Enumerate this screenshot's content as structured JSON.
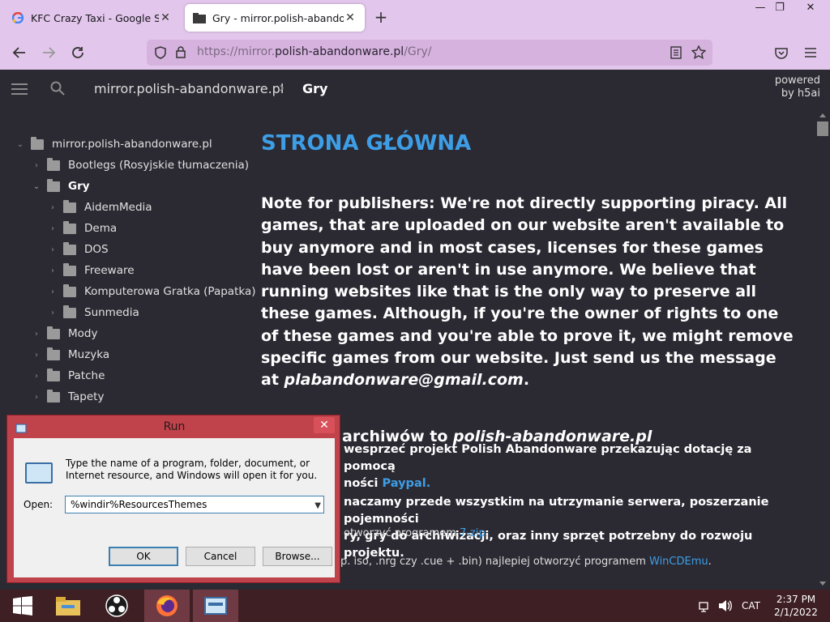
{
  "browser": {
    "tabs": [
      {
        "title": "KFC Crazy Taxi - Google Search",
        "favicon": "google-icon",
        "close": "✕"
      },
      {
        "title": "Gry - mirror.polish-abandonware.pl",
        "favicon": "folder-icon",
        "close": "✕"
      }
    ],
    "new_tab": "+",
    "window_controls": {
      "minimize": "—",
      "maximize": "❐",
      "close": "✕"
    },
    "url": {
      "scheme": "https://",
      "sub": "mirror.",
      "domain": "polish-abandonware.pl",
      "path": "/Gry/"
    }
  },
  "header": {
    "crumb_root": "mirror.polish-abandonware.pl",
    "crumb_sep": "›",
    "crumb_current": "Gry",
    "powered_line1": "powered",
    "powered_line2": "by h5ai"
  },
  "sidebar": {
    "items": [
      {
        "label": "mirror.polish-abandonware.pl",
        "arrow": "⌄"
      },
      {
        "label": "Bootlegs (Rosyjskie tłumaczenia)",
        "arrow": "›"
      },
      {
        "label": "Gry",
        "arrow": "⌄"
      },
      {
        "label": "AidemMedia",
        "arrow": "›"
      },
      {
        "label": "Dema",
        "arrow": "›"
      },
      {
        "label": "DOS",
        "arrow": "›"
      },
      {
        "label": "Freeware",
        "arrow": "›"
      },
      {
        "label": "Komputerowa Gratka (Papatka)",
        "arrow": "›"
      },
      {
        "label": "Sunmedia",
        "arrow": "›"
      },
      {
        "label": "Mody",
        "arrow": "›"
      },
      {
        "label": "Muzyka",
        "arrow": "›"
      },
      {
        "label": "Patche",
        "arrow": "›"
      },
      {
        "label": "Tapety",
        "arrow": "›"
      }
    ]
  },
  "content": {
    "heading": "STRONA GŁÓWNA",
    "note": "Note for publishers: We're not directly supporting piracy. All games, that are uploaded on our website aren't available to buy anymore and in most cases, licenses for these games have been lost or aren't in use anymore. We believe that running websites like that is the only way to preserve all these games. Although, if you're the owner of rights to one of these games and you're able to prove it, we might remove specific games from our website. Just send us the message at ",
    "note_email": "plabandonware@gmail.com",
    "note_end": ".",
    "password_label": "Hasło do archiwów to ",
    "password_value": "polish-abandonware.pl",
    "para1_a": "wesprzeć projekt Polish Abandonware przekazując dotację za pomocą",
    "para1_b": "ności ",
    "para1_link": "Paypal.",
    "para2_a": "naczamy przede wszystkim na utrzymanie serwera, poszerzanie pojemności",
    "para2_b": "ry, gry do archiwizacji, oraz inny sprzęt potrzebny do rozwoju projektu.",
    "line3_text": "otworzyć programem ",
    "line3_link": "7-zip",
    "line3_end": ".",
    "line4_text": "p. iso, .nrg czy .cue + .bin) najlepiej otworzyć programem ",
    "line4_link": "WinCDEmu",
    "line4_end": "."
  },
  "run_dialog": {
    "title": "Run",
    "close": "✕",
    "description": "Type the name of a program, folder, document, or Internet resource, and Windows will open it for you.",
    "open_label": "Open:",
    "input_value": "%windir%ResourcesThemes",
    "ok": "OK",
    "cancel": "Cancel",
    "browse": "Browse..."
  },
  "taskbar": {
    "items": [
      "file-explorer-icon",
      "obs-icon",
      "firefox-icon",
      "run-icon"
    ],
    "lang": "CAT",
    "time": "2:37 PM",
    "date": "2/1/2022"
  },
  "colors": {
    "accent": "#3d9ee6",
    "browser_chrome": "#e3c6ec",
    "page_bg": "#2b2a33",
    "taskbar": "#3e1f24",
    "dialog_frame": "#c0424a"
  }
}
